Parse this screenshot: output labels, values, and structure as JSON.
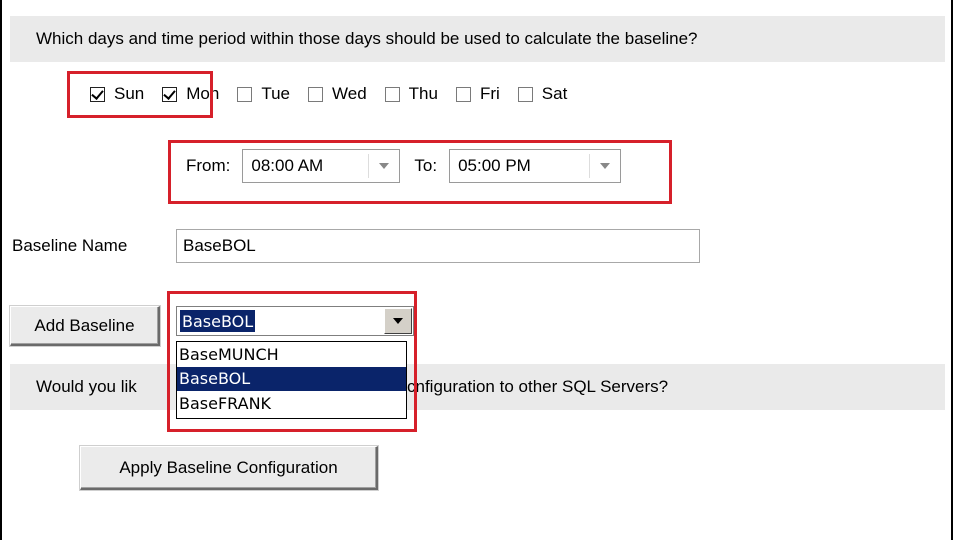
{
  "section1": {
    "prompt": "Which days and time period within those days should be used to calculate the baseline?"
  },
  "days": [
    {
      "label": "Sun",
      "checked": true
    },
    {
      "label": "Mon",
      "checked": true
    },
    {
      "label": "Tue",
      "checked": false
    },
    {
      "label": "Wed",
      "checked": false
    },
    {
      "label": "Thu",
      "checked": false
    },
    {
      "label": "Fri",
      "checked": false
    },
    {
      "label": "Sat",
      "checked": false
    }
  ],
  "time": {
    "from_label": "From:",
    "from_value": "08:00 AM",
    "to_label": "To:",
    "to_value": "05:00 PM"
  },
  "baseline_name": {
    "label": "Baseline Name",
    "value": "BaseBOL"
  },
  "add_button": {
    "label": "Add Baseline"
  },
  "baseline_dropdown": {
    "selected": "BaseBOL",
    "options": [
      "BaseMUNCH",
      "BaseBOL",
      "BaseFRANK"
    ],
    "highlighted_index": 1
  },
  "section2": {
    "prompt_visible_left": "Would you lik",
    "prompt_visible_right": "cnfiguration to other SQL Servers?"
  },
  "apply_button": {
    "label": "Apply Baseline Configuration"
  },
  "colors": {
    "highlight_box": "#d6202a",
    "selection": "#0a246a",
    "band": "#eaeaea"
  }
}
